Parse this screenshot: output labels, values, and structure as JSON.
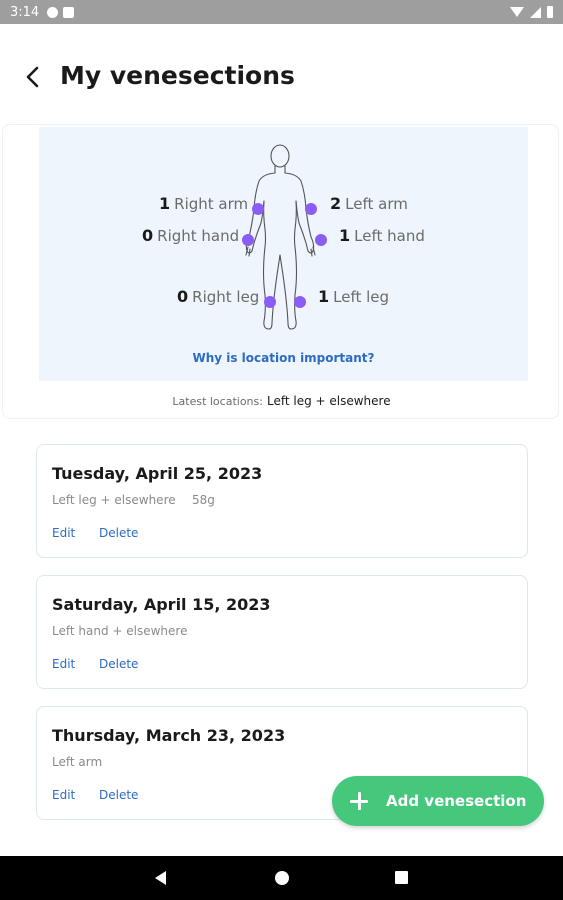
{
  "status_bar": {
    "time": "3:14",
    "icons": [
      "media-icon",
      "sd-card-icon",
      "wifi-icon",
      "signal-icon",
      "battery-icon"
    ]
  },
  "header": {
    "title": "My venesections",
    "back_icon": "chevron-left-icon"
  },
  "body_map": {
    "locations": {
      "right_arm": {
        "count": "1",
        "label": "Right arm"
      },
      "left_arm": {
        "count": "2",
        "label": "Left arm"
      },
      "right_hand": {
        "count": "0",
        "label": "Right hand"
      },
      "left_hand": {
        "count": "1",
        "label": "Left hand"
      },
      "right_leg": {
        "count": "0",
        "label": "Right leg"
      },
      "left_leg": {
        "count": "1",
        "label": "Left leg"
      }
    },
    "why_link": "Why is location important?",
    "latest_label": "Latest locations:",
    "latest_value": "Left leg + elsewhere",
    "colors": {
      "background": "#eef5fd",
      "marker": "#8b5cf6",
      "link": "#2c6bc4"
    }
  },
  "entries": [
    {
      "date": "Tuesday, April 25, 2023",
      "location": "Left leg + elsewhere",
      "weight": "58g",
      "edit": "Edit",
      "delete": "Delete"
    },
    {
      "date": "Saturday, April 15, 2023",
      "location": "Left hand + elsewhere",
      "edit": "Edit",
      "delete": "Delete"
    },
    {
      "date": "Thursday, March 23, 2023",
      "location": "Left arm",
      "edit": "Edit",
      "delete": "Delete"
    }
  ],
  "fab": {
    "label": "Add venesection",
    "icon": "plus-icon",
    "color": "#45c77c"
  },
  "nav_bar": {
    "icons": [
      "back-triangle-icon",
      "home-circle-icon",
      "recents-square-icon"
    ]
  }
}
